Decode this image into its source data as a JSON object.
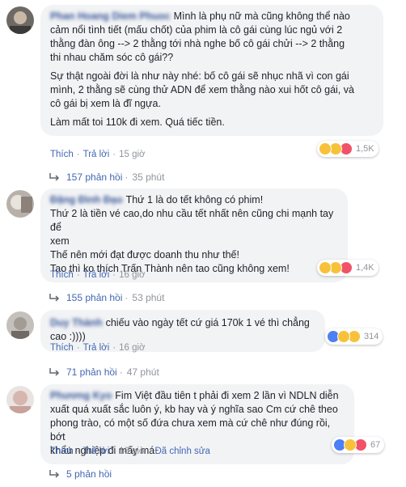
{
  "comments": [
    {
      "author": "Phan Hoang Diem Phuoc",
      "paragraphs": [
        "Mình là phụ nữ mà cũng không thể nào\ncảm nổi tình tiết (mấu chốt) của phim là cô gái cùng lúc ngủ với 2\nthằng đàn ông --> 2 thằng tới nhà nghe bố cô gái chửi --> 2 thằng\nthi nhau chăm sóc cô gái??",
        "Sự thật ngoài đời là như này nhé: bố cô gái sẽ nhục nhã vì con gái\nmình, 2 thằng sẽ cùng thử ADN để xem thằng nào xui hốt cô gái, và\ncô gái bị xem là đĩ ngựa.",
        "Làm mất toi 110k đi xem. Quá tiếc tiền."
      ],
      "like_label": "Thích",
      "reply_label": "Trả lời",
      "time": "15 giờ",
      "reaction_count": "1,5K",
      "reactions": [
        "haha-icon",
        "wow-icon",
        "heart-icon"
      ],
      "replies_label": "157 phản hồi",
      "replies_time": "35 phút"
    },
    {
      "author": "Đặng Đình Đạo",
      "paragraphs": [
        "Thứ 1 là do tết không có phim!\nThứ 2 là tiền vé cao,do nhu cầu tết nhất nên cũng chi mạnh tay để\nxem\nThế nên mới đạt được doanh thu như thế!\nTao thì ko thích Trấn Thành nên tao cũng không xem!"
      ],
      "like_label": "Thích",
      "reply_label": "Trả lời",
      "time": "16 giờ",
      "reaction_count": "1,4K",
      "reactions": [
        "haha-icon",
        "wow-icon",
        "heart-icon"
      ],
      "replies_label": "155 phản hồi",
      "replies_time": "53 phút"
    },
    {
      "author": "Duy Thành",
      "paragraphs": [
        "chiếu vào ngày tết cứ giá 170k 1 vé thì chẳng cao :))))"
      ],
      "like_label": "Thích",
      "reply_label": "Trả lời",
      "time": "16 giờ",
      "reaction_count": "314",
      "reactions": [
        "like-icon",
        "haha-icon",
        "wow-icon"
      ],
      "replies_label": "71 phản hồi",
      "replies_time": "47 phút"
    },
    {
      "author": "Phương Kyo",
      "paragraphs": [
        "Fim Việt đầu tiên t phải đi xem 2 lần vì NDLN diễn\nxuất quá xuất sắc luôn ý, kb hay và ý nghĩa sao Cm cứ chê theo\nphong trào, có một số đứa chưa xem mà cứ chê như đúng rồi, bớt\nkhẩu nghiệp đi mấy má"
      ],
      "like_label": "Thích",
      "reply_label": "Trả lời",
      "time": "16 giờ",
      "edited_label": "Đã chỉnh sửa",
      "reaction_count": "67",
      "reactions": [
        "like-icon",
        "haha-icon",
        "heart-icon"
      ],
      "replies_label": "5 phản hồi"
    }
  ]
}
